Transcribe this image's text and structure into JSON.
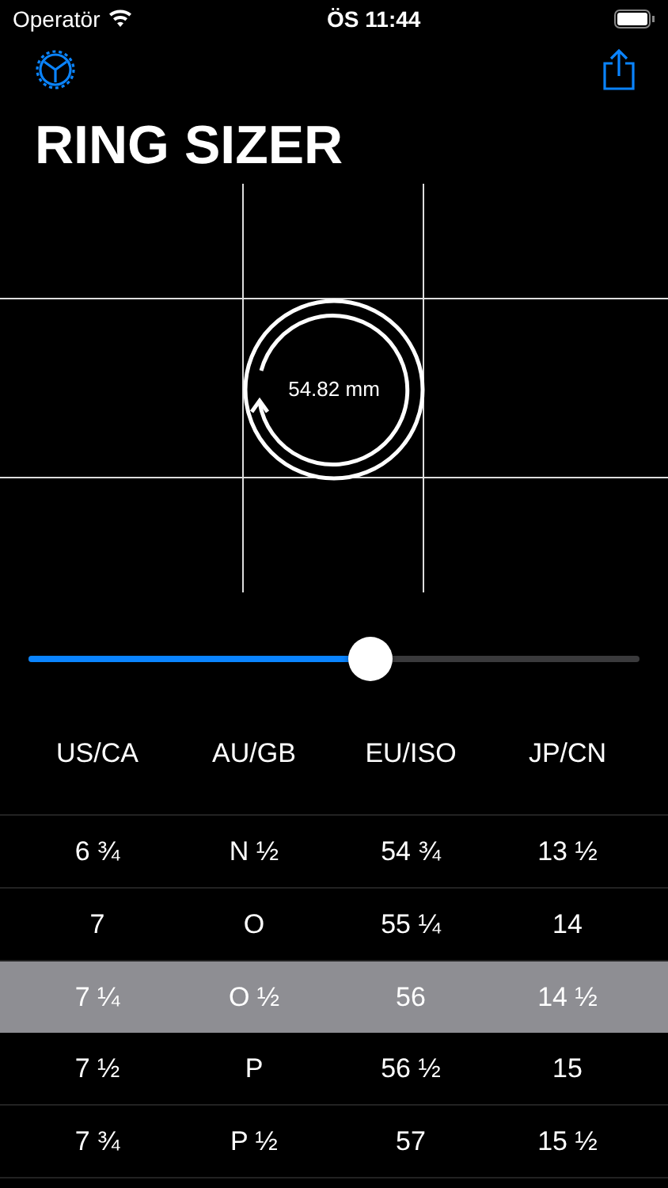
{
  "status_bar": {
    "carrier": "Operatör",
    "time": "ÖS 11:44"
  },
  "title": "RING SIZER",
  "ring": {
    "reading": "54.82 mm"
  },
  "slider": {
    "level": 0.56
  },
  "table": {
    "columns": [
      "US/CA",
      "AU/GB",
      "EU/ISO",
      "JP/CN"
    ],
    "rows": [
      {
        "cells": [
          "6 ¾",
          "N ½",
          "54 ¾",
          "13 ½"
        ],
        "selected": false
      },
      {
        "cells": [
          "7",
          "O",
          "55 ¼",
          "14"
        ],
        "selected": false
      },
      {
        "cells": [
          "7 ¼",
          "O ½",
          "56",
          "14 ½"
        ],
        "selected": true
      },
      {
        "cells": [
          "7 ½",
          "P",
          "56 ½",
          "15"
        ],
        "selected": false
      },
      {
        "cells": [
          "7 ¾",
          "P ½",
          "57",
          "15 ½"
        ],
        "selected": false
      }
    ]
  }
}
